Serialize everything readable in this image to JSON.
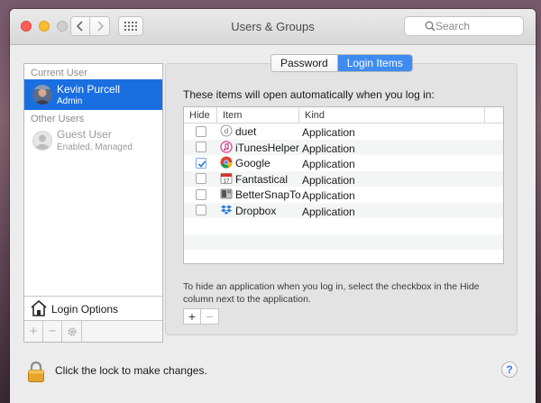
{
  "window": {
    "title": "Users & Groups",
    "search_placeholder": "Search"
  },
  "sidebar": {
    "current_header": "Current User",
    "current_user": {
      "name": "Kevin Purcell",
      "role": "Admin"
    },
    "other_header": "Other Users",
    "guest_user": {
      "name": "Guest User",
      "status": "Enabled, Managed"
    },
    "login_options_label": "Login Options",
    "buttons": {
      "add": "+",
      "remove": "−",
      "gear": "gear-icon"
    }
  },
  "tabs": {
    "password": "Password",
    "login_items": "Login Items",
    "selected": "Login Items"
  },
  "login_items": {
    "description": "These items will open automatically when you log in:",
    "columns": {
      "hide": "Hide",
      "item": "Item",
      "kind": "Kind"
    },
    "rows": [
      {
        "name": "duet",
        "kind": "Application",
        "hide": false,
        "icon": "duet-icon"
      },
      {
        "name": "iTunesHelper",
        "kind": "Application",
        "hide": false,
        "icon": "itunes-icon"
      },
      {
        "name": "Google",
        "kind": "Application",
        "hide": true,
        "icon": "chrome-icon"
      },
      {
        "name": "Fantastical",
        "kind": "Application",
        "hide": false,
        "icon": "calendar-icon"
      },
      {
        "name": "BetterSnapTo",
        "kind": "Application",
        "hide": false,
        "icon": "bettersnap-icon"
      },
      {
        "name": "Dropbox",
        "kind": "Application",
        "hide": false,
        "icon": "dropbox-icon"
      }
    ],
    "help_text": "To hide an application when you log in, select the checkbox in the Hide column next to the application.",
    "add_label": "+",
    "remove_label": "−"
  },
  "footer": {
    "lock_text": "Click the lock to make changes.",
    "help_label": "?"
  },
  "colors": {
    "selection": "#1a6fe0",
    "tab_selected": "#3e8cf0",
    "close": "#fc5f57",
    "minimize": "#fdbc2e"
  }
}
